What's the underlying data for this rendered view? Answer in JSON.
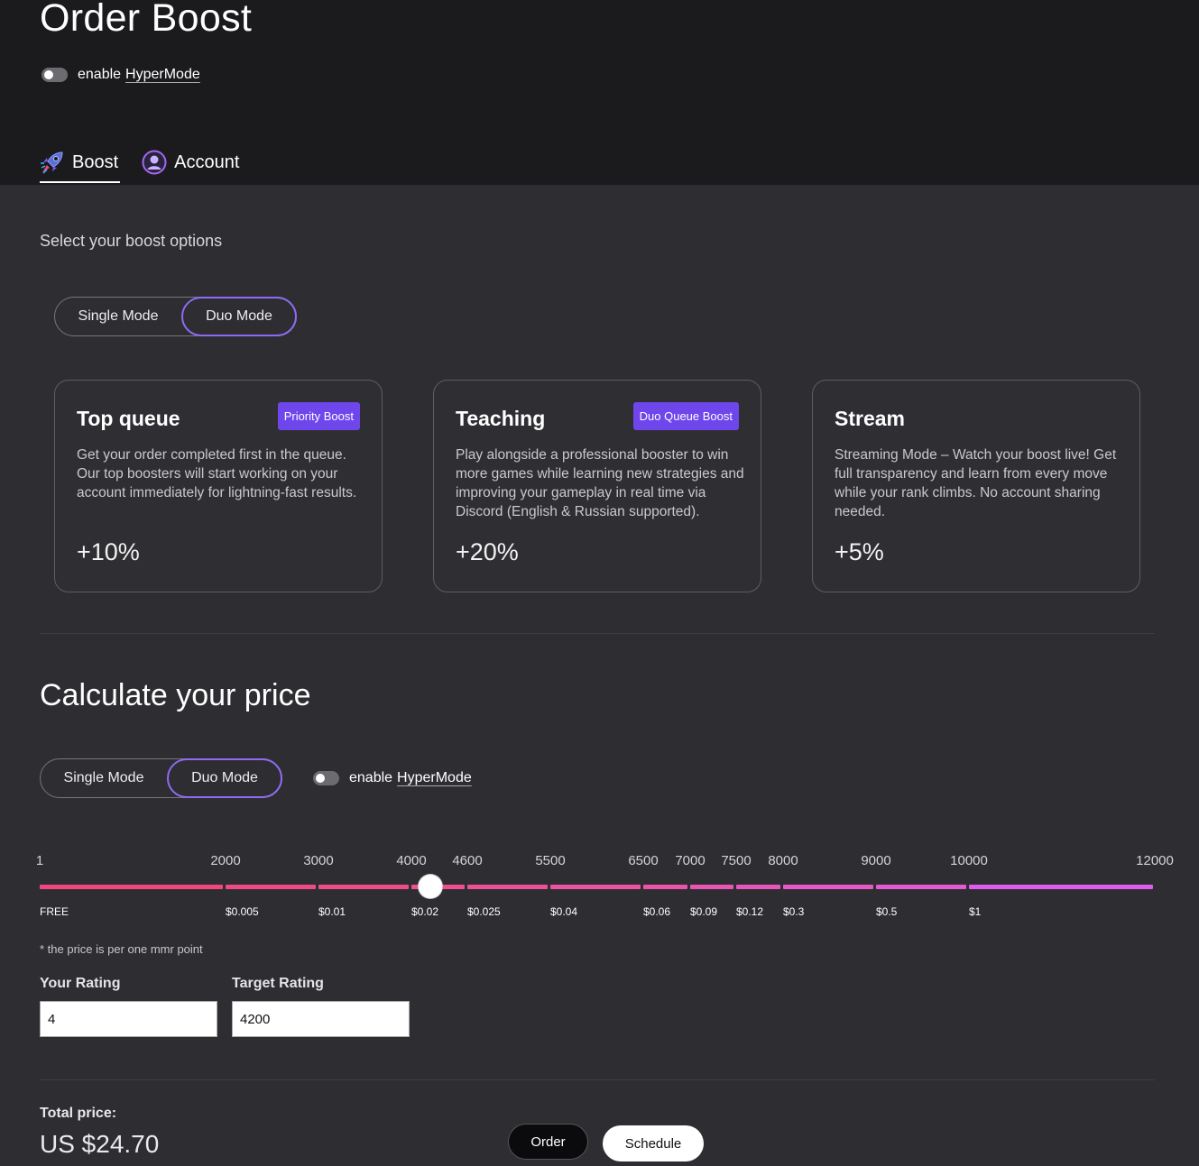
{
  "header": {
    "title": "Order Boost",
    "hypermode": {
      "prefix": "enable",
      "link": "HyperMode",
      "enabled": false
    }
  },
  "tabs": [
    {
      "label": "Boost",
      "icon": "rocket-icon",
      "active": true
    },
    {
      "label": "Account",
      "icon": "user-circle-icon",
      "active": false
    }
  ],
  "boost_options": {
    "subtitle": "Select your boost options",
    "mode_toggle": {
      "options": [
        "Single Mode",
        "Duo Mode"
      ],
      "selected": "Duo Mode"
    },
    "cards": [
      {
        "title": "Top queue",
        "badge": "Priority Boost",
        "description": "Get your order completed first in the queue. Our top boosters will start working on your account immediately for lightning-fast results.",
        "percent": "+10%"
      },
      {
        "title": "Teaching",
        "badge": "Duo Queue Boost",
        "description": "Play alongside a professional booster to win more games while learning new strategies and improving your gameplay in real time via Discord (English & Russian supported).",
        "percent": "+20%"
      },
      {
        "title": "Stream",
        "badge": "",
        "description": "Streaming Mode – Watch your boost live! Get full transparency and learn from every move while your rank climbs. No account sharing needed.",
        "percent": "+5%"
      }
    ]
  },
  "calculator": {
    "title": "Calculate your price",
    "mode_toggle": {
      "options": [
        "Single Mode",
        "Duo Mode"
      ],
      "selected": "Duo Mode"
    },
    "hypermode": {
      "prefix": "enable",
      "link": "HyperMode",
      "enabled": false
    },
    "slider": {
      "ticks": [
        "1",
        "2000",
        "3000",
        "4000",
        "4600",
        "5500",
        "6500",
        "7000",
        "7500",
        "8000",
        "9000",
        "10000",
        "12000"
      ],
      "prices": [
        "FREE",
        "$0.005",
        "$0.01",
        "$0.02",
        "$0.025",
        "$0.04",
        "$0.06",
        "$0.09",
        "$0.12",
        "$0.3",
        "$0.5",
        "$1"
      ],
      "thumb_value": 4200,
      "colors": {
        "start": "#f0487c",
        "end": "#e05cf0"
      }
    },
    "note": "* the price is per one mmr point",
    "your_rating": {
      "label": "Your Rating",
      "value": "4"
    },
    "target_rating": {
      "label": "Target Rating",
      "value": "4200"
    }
  },
  "summary": {
    "total_label": "Total price:",
    "total_value": "US $24.70",
    "order_label": "Order",
    "schedule_label": "Schedule"
  },
  "colors": {
    "accent": "#8d6cf4",
    "badge": "#6e46ec",
    "header_bg": "#1b1a1d",
    "page_bg": "#2e2d32"
  }
}
